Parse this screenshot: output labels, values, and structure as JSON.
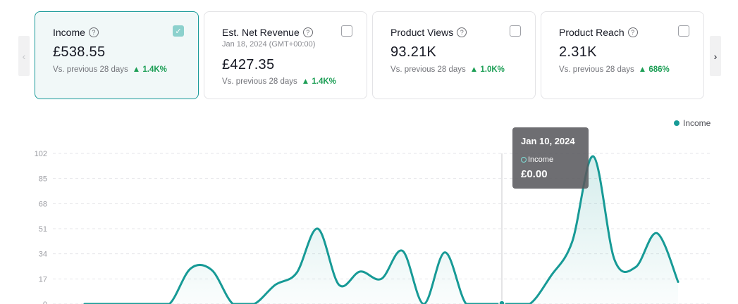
{
  "cards": [
    {
      "title": "Income",
      "subtitle": "",
      "value": "£538.55",
      "compare": "Vs. previous 28 days",
      "delta": "1.4K%",
      "checked": true
    },
    {
      "title": "Est. Net Revenue",
      "subtitle": "Jan 18, 2024 (GMT+00:00)",
      "value": "£427.35",
      "compare": "Vs. previous 28 days",
      "delta": "1.4K%",
      "checked": false
    },
    {
      "title": "Product Views",
      "subtitle": "",
      "value": "93.21K",
      "compare": "Vs. previous 28 days",
      "delta": "1.0K%",
      "checked": false
    },
    {
      "title": "Product Reach",
      "subtitle": "",
      "value": "2.31K",
      "compare": "Vs. previous 28 days",
      "delta": "686%",
      "checked": false
    }
  ],
  "icons": {
    "prev": "chevron-left-icon",
    "next": "chevron-right-icon",
    "help": "question-circle-icon",
    "delta": "arrow-up-icon"
  },
  "nav": {
    "prev": "‹",
    "next": "›"
  },
  "colors": {
    "accent": "#179a96",
    "delta": "#1c9e55"
  },
  "legend": {
    "label": "Income"
  },
  "tooltip": {
    "date": "Jan 10, 2024",
    "series": "Income",
    "value": "£0.00"
  },
  "chart_data": {
    "type": "area",
    "yticks": [
      0,
      17,
      34,
      51,
      68,
      85,
      102
    ],
    "ylim": [
      0,
      102
    ],
    "grid": true,
    "legend_placement": "top-right",
    "series": [
      {
        "name": "Income",
        "values": [
          0,
          0,
          0,
          0,
          0,
          24,
          23,
          0,
          0,
          13,
          21,
          51,
          13,
          22,
          17,
          36,
          0,
          35,
          0,
          0,
          0,
          0,
          19,
          42,
          100,
          30,
          25,
          48,
          15
        ]
      }
    ]
  }
}
